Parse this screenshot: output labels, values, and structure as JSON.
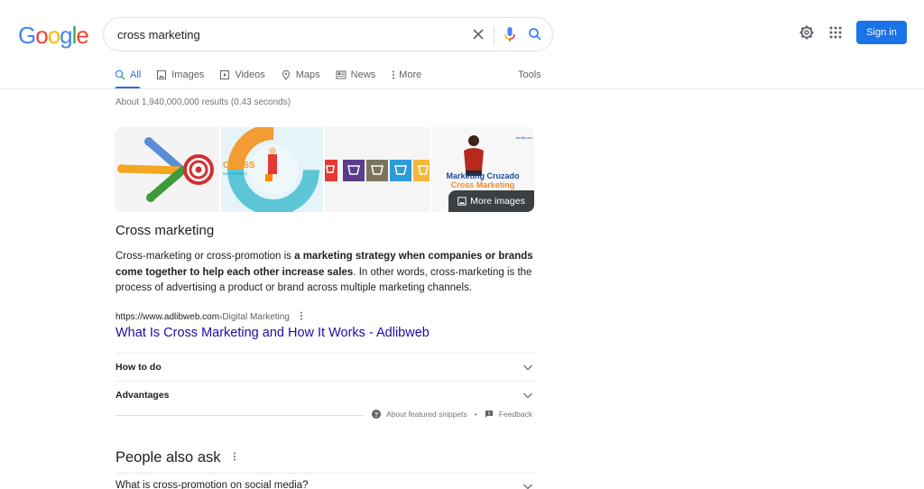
{
  "logo": {
    "letters": [
      "G",
      "o",
      "o",
      "g",
      "l",
      "e"
    ],
    "colors": [
      "#4285f4",
      "#ea4335",
      "#fbbc05",
      "#4285f4",
      "#34a853",
      "#ea4335"
    ]
  },
  "search": {
    "query": "cross marketing",
    "clear_icon": "close-icon",
    "mic_icon": "microphone-icon",
    "search_icon": "search-icon"
  },
  "header": {
    "settings_icon": "gear-icon",
    "apps_icon": "grid-icon",
    "signin_label": "Sign in",
    "accent": "#1a73e8"
  },
  "tabs": [
    {
      "label": "All",
      "icon": "search-icon",
      "active": true
    },
    {
      "label": "Images",
      "icon": "image-icon"
    },
    {
      "label": "Videos",
      "icon": "play-icon"
    },
    {
      "label": "Maps",
      "icon": "map-pin-icon"
    },
    {
      "label": "News",
      "icon": "newspaper-icon"
    },
    {
      "label": "More",
      "icon": "more-vertical-icon"
    }
  ],
  "tools_label": "Tools",
  "stats": "About 1,940,000,000 results (0.43 seconds)",
  "images": {
    "img2_title": "CROSS",
    "img2_subtitle": "MARKETING",
    "img4_title": "Marketing Cruzado",
    "img4_subtitle": "Cross Marketing",
    "img4_source": "tuvuffy.com",
    "more_images_label": "More images"
  },
  "snippet": {
    "title": "Cross marketing",
    "text_1": "Cross-marketing or cross-promotion is ",
    "text_bold": "a marketing strategy when companies or brands come together to help each other increase sales",
    "text_2": ". In other words, cross-marketing is the process of advertising a product or brand across multiple marketing channels.",
    "cite_url": "https://www.adlibweb.com",
    "cite_sep": " › ",
    "cite_crumb": "Digital Marketing",
    "result_title": "What Is Cross Marketing and How It Works - Adlibweb",
    "accordions": [
      {
        "label": "How to do"
      },
      {
        "label": "Advantages"
      }
    ],
    "about_label": "About featured snippets",
    "dot": "•",
    "feedback_label": "Feedback"
  },
  "people_also_ask": {
    "title": "People also ask",
    "questions": [
      {
        "label": "What is cross-promotion on social media?"
      }
    ]
  }
}
